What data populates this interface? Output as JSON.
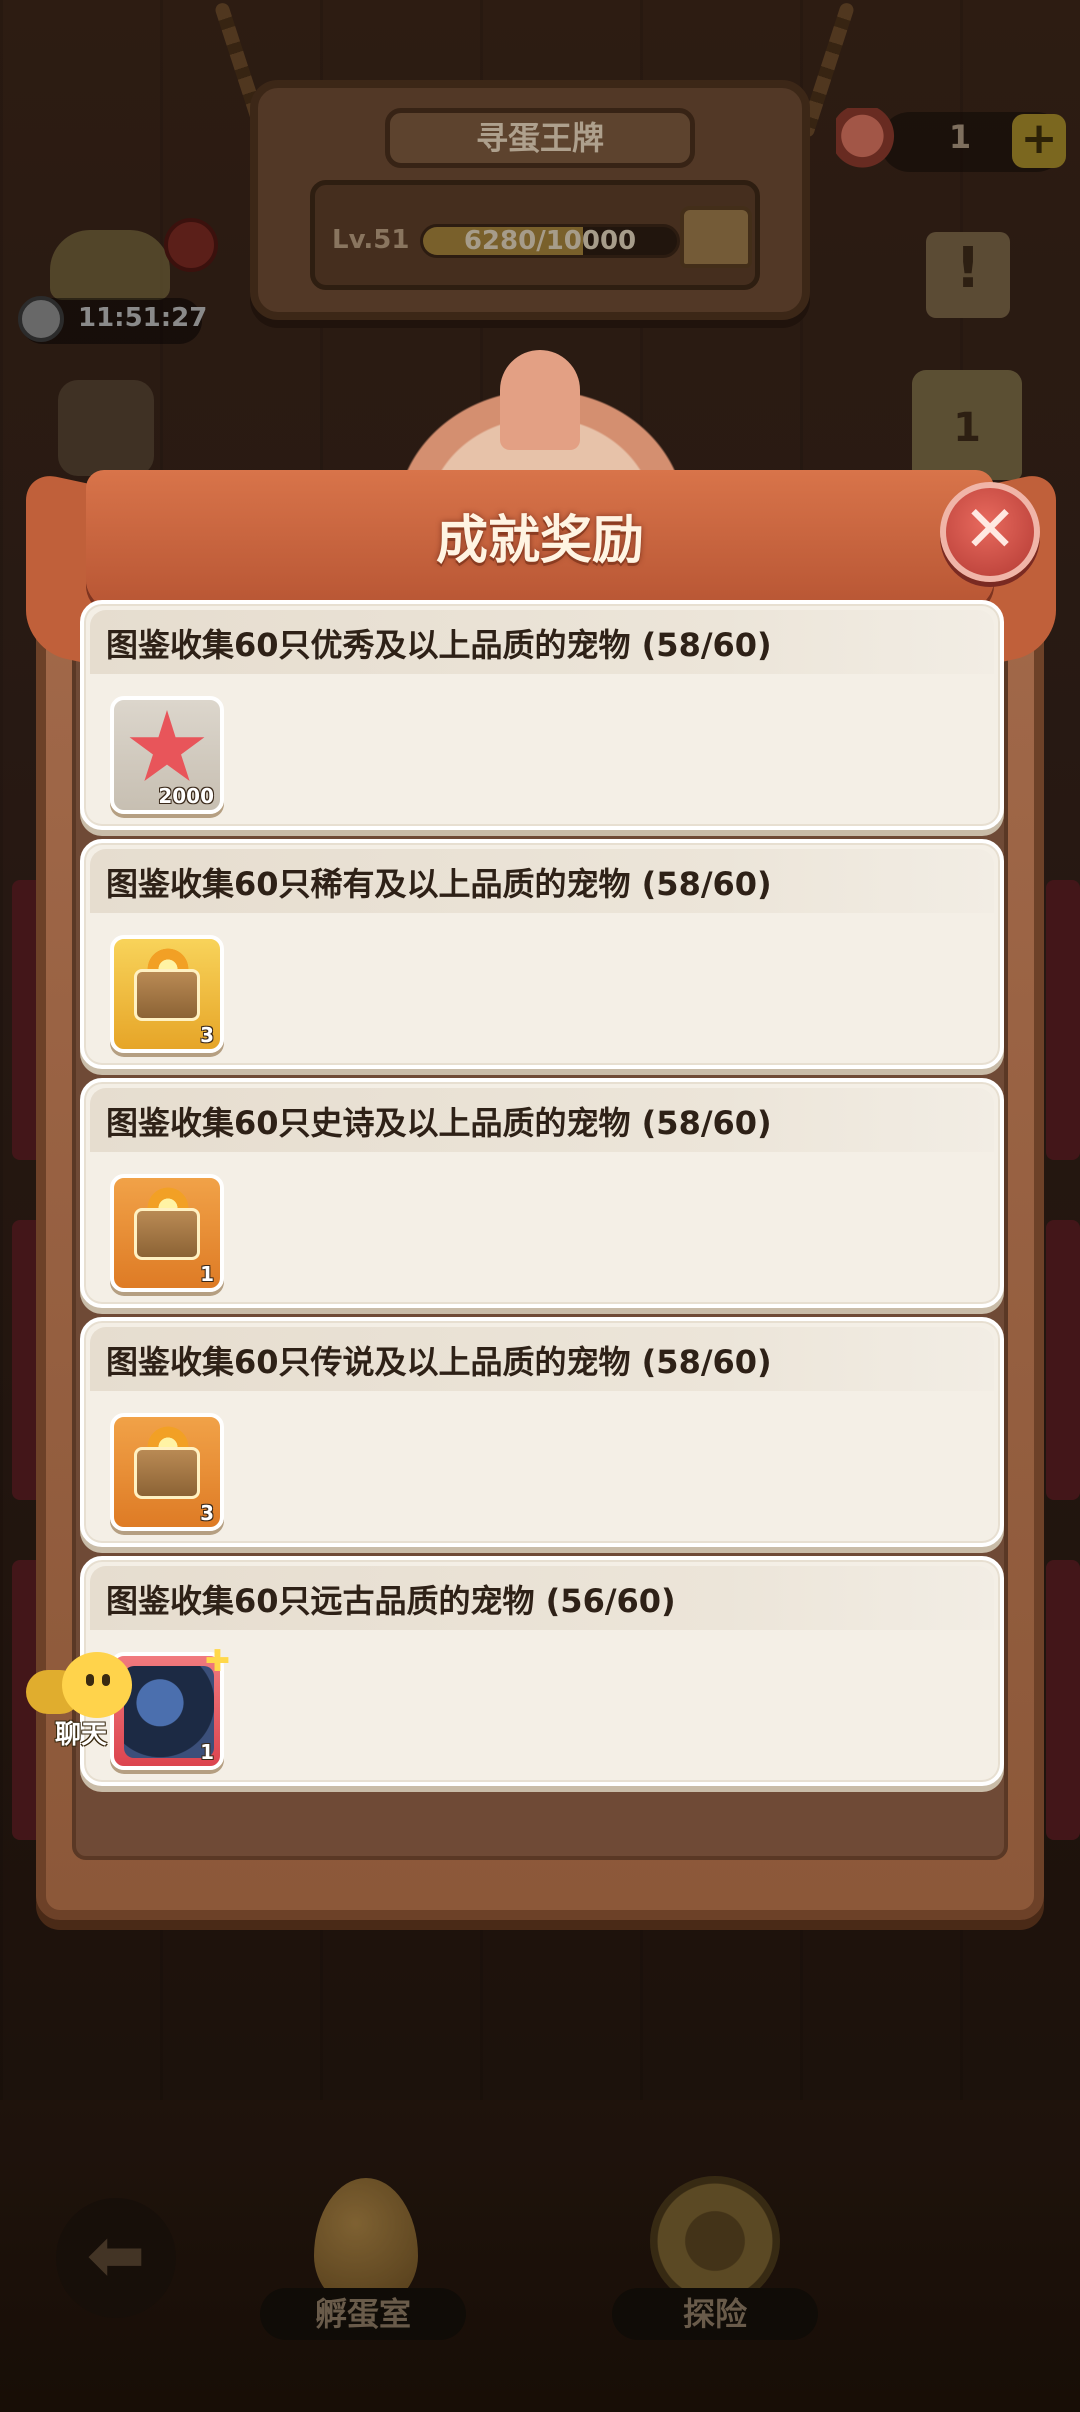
{
  "background": {
    "sign_title": "寻蛋王牌",
    "level_label": "Lv.51",
    "xp_text": "6280/10000",
    "xp_fraction": 0.628,
    "meat_count": "1",
    "timer": "11:51:27",
    "nav": {
      "hatchery_label": "孵蛋室",
      "explore_label": "探险"
    }
  },
  "modal": {
    "title": "成就奖励",
    "close_symbol": "✕",
    "achievements": [
      {
        "title": "图鉴收集60只优秀及以上品质的宠物 (58/60)",
        "reward_count": "2000",
        "reward_icon": "starfish-icon",
        "reward_color": "#c9c1b4"
      },
      {
        "title": "图鉴收集60只稀有及以上品质的宠物 (58/60)",
        "reward_count": "3",
        "reward_icon": "gold-chest-icon",
        "reward_color": "#f3c442"
      },
      {
        "title": "图鉴收集60只史诗及以上品质的宠物 (58/60)",
        "reward_count": "1",
        "reward_icon": "gold-chest-icon",
        "reward_color": "#ea9038"
      },
      {
        "title": "图鉴收集60只传说及以上品质的宠物 (58/60)",
        "reward_count": "3",
        "reward_icon": "gold-chest-icon",
        "reward_color": "#ea9038"
      },
      {
        "title": "图鉴收集60只远古品质的宠物 (56/60)",
        "reward_count": "1",
        "reward_icon": "dragon-pet-icon",
        "reward_color": "#e6525a"
      }
    ]
  },
  "chat": {
    "label": "聊天"
  }
}
